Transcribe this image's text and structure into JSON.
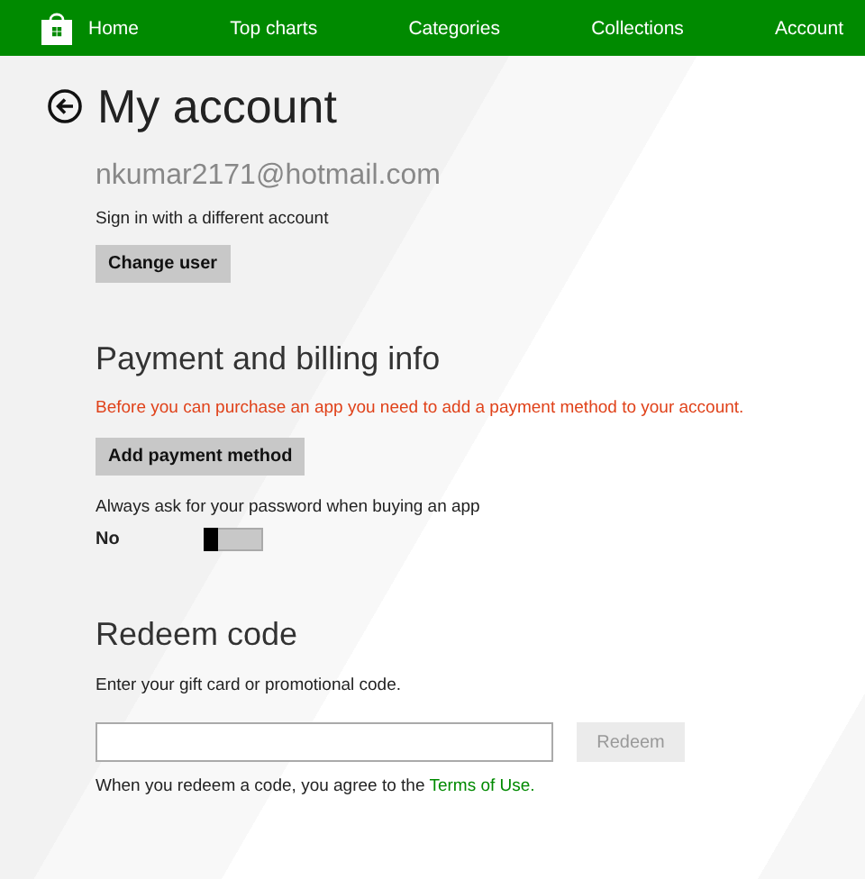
{
  "nav": {
    "items": [
      {
        "label": "Home"
      },
      {
        "label": "Top charts"
      },
      {
        "label": "Categories"
      },
      {
        "label": "Collections"
      },
      {
        "label": "Account"
      }
    ]
  },
  "page": {
    "title": "My account"
  },
  "account": {
    "email": "nkumar2171@hotmail.com",
    "hint": "Sign in with a different account",
    "button": "Change user"
  },
  "billing": {
    "heading": "Payment and billing info",
    "warning": "Before you can purchase an app you need to add a payment method to your account.",
    "button": "Add payment method",
    "password_label": "Always ask for your password when buying an app",
    "toggle": {
      "label": "No",
      "on": false
    }
  },
  "redeem": {
    "heading": "Redeem code",
    "hint": "Enter your gift card or promotional code.",
    "button": {
      "label": "Redeem",
      "disabled": true
    },
    "terms": {
      "text": "When you redeem a code, you agree to the ",
      "link": "Terms of Use."
    }
  }
}
